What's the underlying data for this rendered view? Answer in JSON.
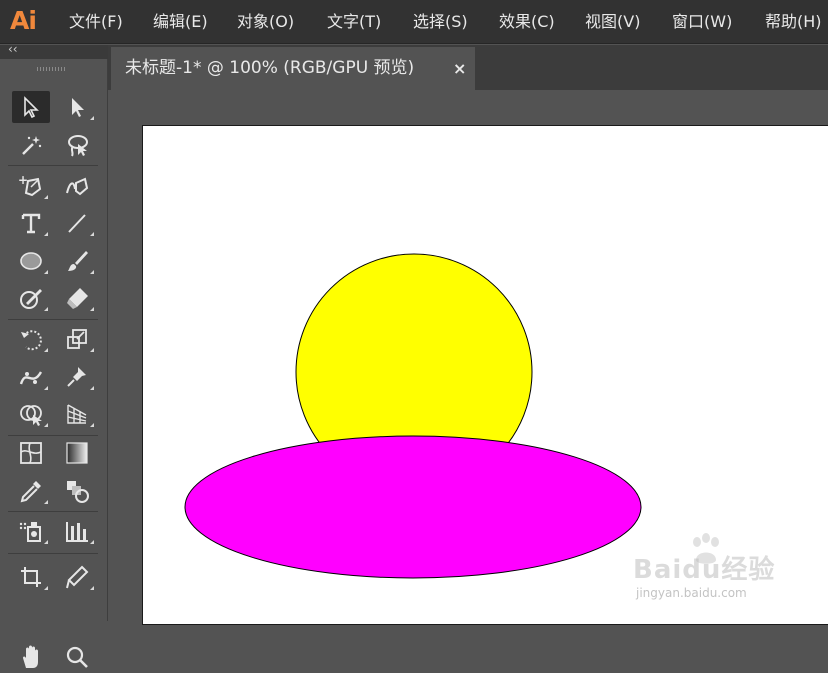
{
  "app": {
    "logo_text": "Ai",
    "accent_color": "#f0883c"
  },
  "menu": {
    "items": [
      {
        "label": "文件(F)"
      },
      {
        "label": "编辑(E)"
      },
      {
        "label": "对象(O)"
      },
      {
        "label": "文字(T)"
      },
      {
        "label": "选择(S)"
      },
      {
        "label": "效果(C)"
      },
      {
        "label": "视图(V)"
      },
      {
        "label": "窗口(W)"
      },
      {
        "label": "帮助(H)"
      }
    ]
  },
  "toolbar": {
    "collapse_glyph": "‹‹",
    "tools": [
      {
        "icon": "selection-arrow-icon",
        "active": true
      },
      {
        "icon": "direct-selection-icon"
      },
      {
        "icon": "magic-wand-icon"
      },
      {
        "icon": "lasso-icon"
      },
      {
        "icon": "pen-tool-icon"
      },
      {
        "icon": "curvature-pen-icon"
      },
      {
        "icon": "type-tool-icon"
      },
      {
        "icon": "line-segment-icon"
      },
      {
        "icon": "ellipse-tool-icon"
      },
      {
        "icon": "paintbrush-icon"
      },
      {
        "icon": "shaper-tool-icon"
      },
      {
        "icon": "eraser-icon"
      },
      {
        "icon": "rotate-tool-icon"
      },
      {
        "icon": "scale-tool-icon"
      },
      {
        "icon": "width-warp-icon"
      },
      {
        "icon": "puppet-warp-pin-icon"
      },
      {
        "icon": "shape-builder-icon"
      },
      {
        "icon": "perspective-grid-icon"
      },
      {
        "icon": "mesh-tool-icon"
      },
      {
        "icon": "gradient-tool-icon"
      },
      {
        "icon": "eyedropper-icon"
      },
      {
        "icon": "blend-tool-icon"
      },
      {
        "icon": "symbol-sprayer-icon"
      },
      {
        "icon": "column-graph-icon"
      },
      {
        "icon": "artboard-tool-icon"
      },
      {
        "icon": "slice-tool-icon"
      },
      {
        "icon": "hand-tool-icon"
      },
      {
        "icon": "zoom-tool-icon"
      }
    ]
  },
  "document": {
    "tab_title": "未标题-1* @ 100% (RGB/GPU 预览)",
    "close_glyph": "×"
  },
  "artwork": {
    "circle": {
      "fill": "#ffff00",
      "stroke": "#000000"
    },
    "ellipse": {
      "fill": "#ff00ff",
      "stroke": "#000000"
    }
  },
  "watermark": {
    "brand": "Baidu经验",
    "url": "jingyan.baidu.com"
  }
}
